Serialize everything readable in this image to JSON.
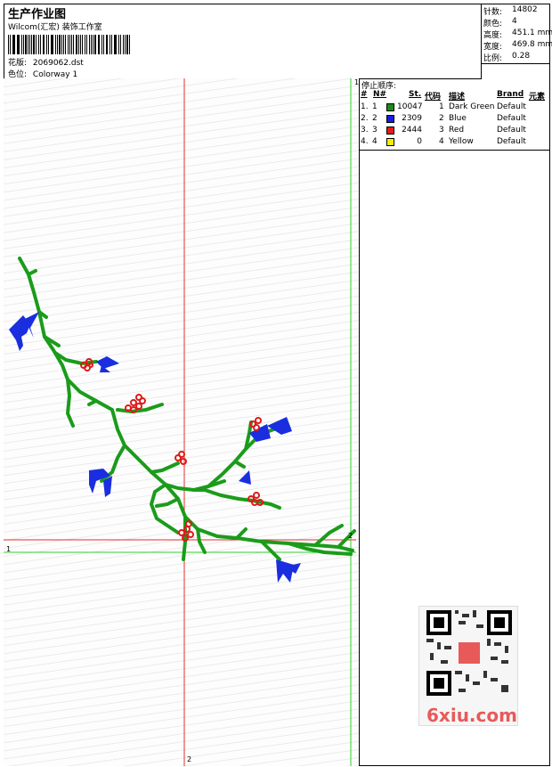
{
  "header": {
    "title": "生产作业图",
    "company": "Wilcom(汇宏) 装饰工作室",
    "file_label": "花版:",
    "file_value": "2069062.dst",
    "colorway_label": "色位:",
    "colorway_value": "Colorway 1"
  },
  "stats": {
    "stitches_label": "针数:",
    "stitches_value": "14802",
    "colors_label": "颜色:",
    "colors_value": "4",
    "height_label": "高度:",
    "height_value": "451.1 mm",
    "width_label": "宽度:",
    "width_value": "469.8 mm",
    "scale_label": "比例:",
    "scale_value": "0.28"
  },
  "stop_sequence": {
    "title": "停止顺序:",
    "headers": {
      "num": "#",
      "n": "N#",
      "st": "St.",
      "code": "代码",
      "desc": "描述",
      "brand": "Brand",
      "element": "元素"
    },
    "rows": [
      {
        "num": "1.",
        "n": "1",
        "color": "#1a8c1a",
        "st": "10047",
        "code": "1",
        "desc": "Dark Green",
        "brand": "Default"
      },
      {
        "num": "2.",
        "n": "2",
        "color": "#1a1ae6",
        "st": "2309",
        "code": "2",
        "desc": "Blue",
        "brand": "Default"
      },
      {
        "num": "3.",
        "n": "3",
        "color": "#e61a1a",
        "st": "2444",
        "code": "3",
        "desc": "Red",
        "brand": "Default"
      },
      {
        "num": "4.",
        "n": "4",
        "color": "#f0f000",
        "st": "0",
        "code": "4",
        "desc": "Yellow",
        "brand": "Default"
      }
    ]
  },
  "guides": {
    "label_1": "1",
    "label_2": "2"
  },
  "watermark": {
    "text": "6xiu.com"
  }
}
